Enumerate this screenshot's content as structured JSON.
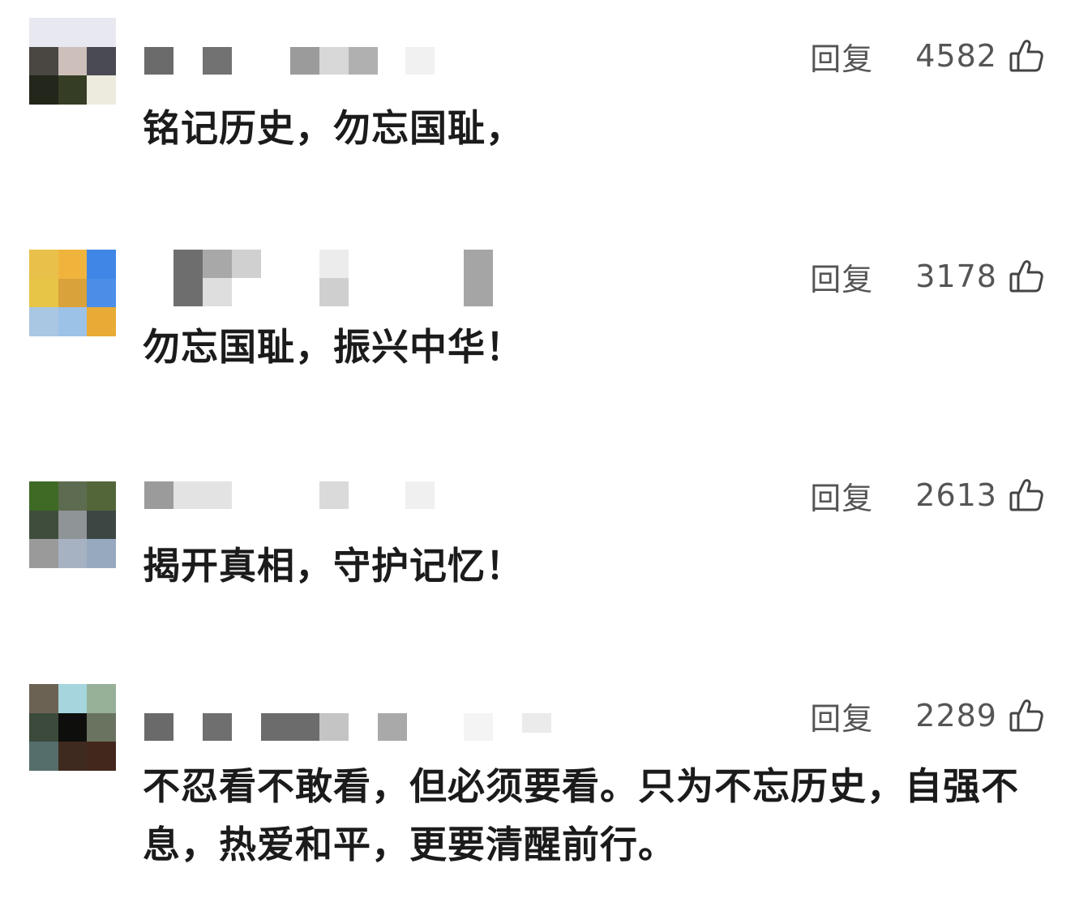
{
  "comments": [
    {
      "reply_label": "回复",
      "likes": "4582",
      "text": "铭记历史，勿忘国耻，",
      "avatar_colors": [
        "#e8e8f0",
        "#e8e8f0",
        "#e8e8f0",
        "#4a4641",
        "#cdbfba",
        "#4a4a55",
        "#23261a",
        "#353e25",
        "#ecebdd"
      ]
    },
    {
      "reply_label": "回复",
      "likes": "3178",
      "text": "勿忘国耻，振兴中华！",
      "avatar_colors": [
        "#e9c04a",
        "#f0b43d",
        "#3f86e6",
        "#e7c547",
        "#d9a23a",
        "#4a8ee8",
        "#a9c6e3",
        "#9cc2e8",
        "#e8ab35"
      ]
    },
    {
      "reply_label": "回复",
      "likes": "2613",
      "text": "揭开真相，守护记忆！",
      "avatar_colors": [
        "#3e6a25",
        "#5d6b50",
        "#52663a",
        "#3f4d3c",
        "#8f9497",
        "#3c4743",
        "#9a9a9a",
        "#a6b2c2",
        "#97a9be"
      ]
    },
    {
      "reply_label": "回复",
      "likes": "2289",
      "text": "不忍看不敢看，但必须要看。只为不忘历史，自强不息，热爱和平，更要清醒前行。",
      "avatar_colors": [
        "#6c6253",
        "#a6d5de",
        "#97b199",
        "#3c4a3b",
        "#0e0f0c",
        "#6a7260",
        "#556e6c",
        "#3f2a1f",
        "#43271c"
      ]
    }
  ]
}
